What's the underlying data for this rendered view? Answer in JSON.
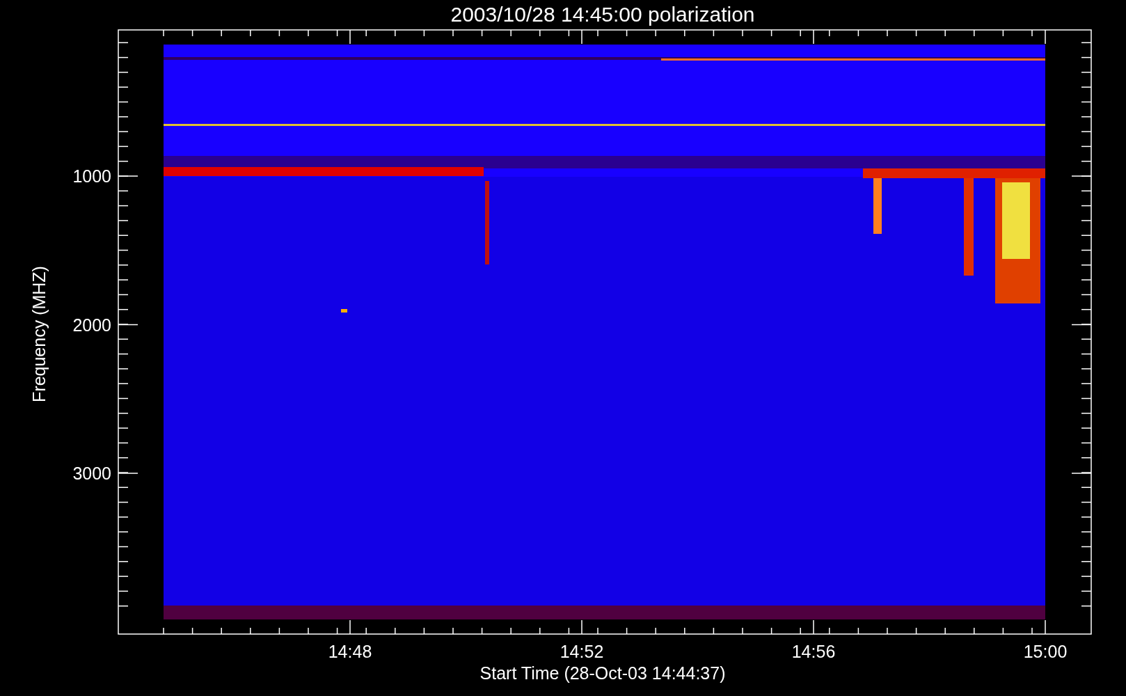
{
  "title": "2003/10/28 14:45:00 polarization",
  "y_axis": {
    "label": "Frequency (MHZ)",
    "ticks": [
      "1000",
      "2000",
      "3000"
    ]
  },
  "x_axis": {
    "label": "Start Time (28-Oct-03 14:44:37)",
    "ticks": [
      "14:48",
      "14:52",
      "14:56",
      "15:00"
    ]
  }
}
